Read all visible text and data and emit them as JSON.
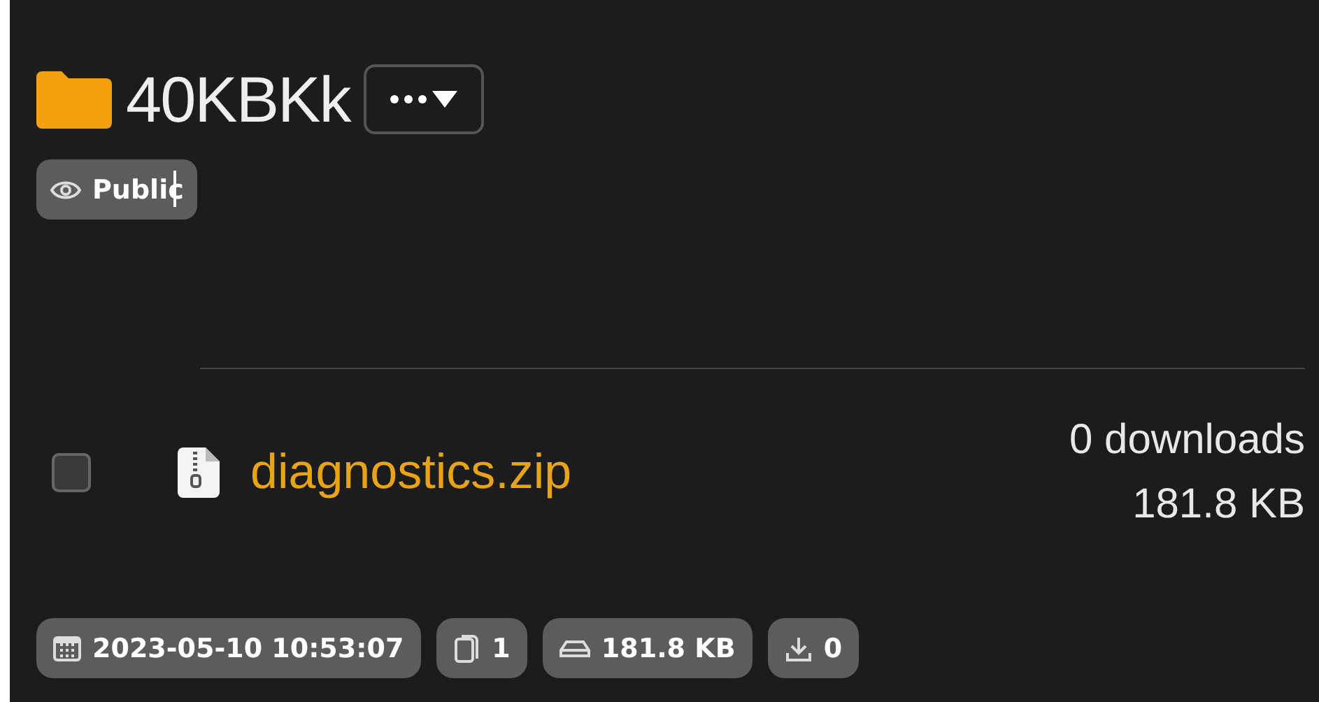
{
  "folder": {
    "name": "40KBKk",
    "visibility": "Public"
  },
  "files": [
    {
      "name": "diagnostics.zip",
      "checked": false,
      "downloads": "0 downloads",
      "size": "181.8 KB"
    }
  ],
  "stats": [
    {
      "kind": "date",
      "text": "2023-05-10 10:53:07"
    },
    {
      "kind": "files",
      "text": "1"
    },
    {
      "kind": "size",
      "text": "181.8 KB"
    },
    {
      "kind": "downloads",
      "text": "0"
    }
  ]
}
